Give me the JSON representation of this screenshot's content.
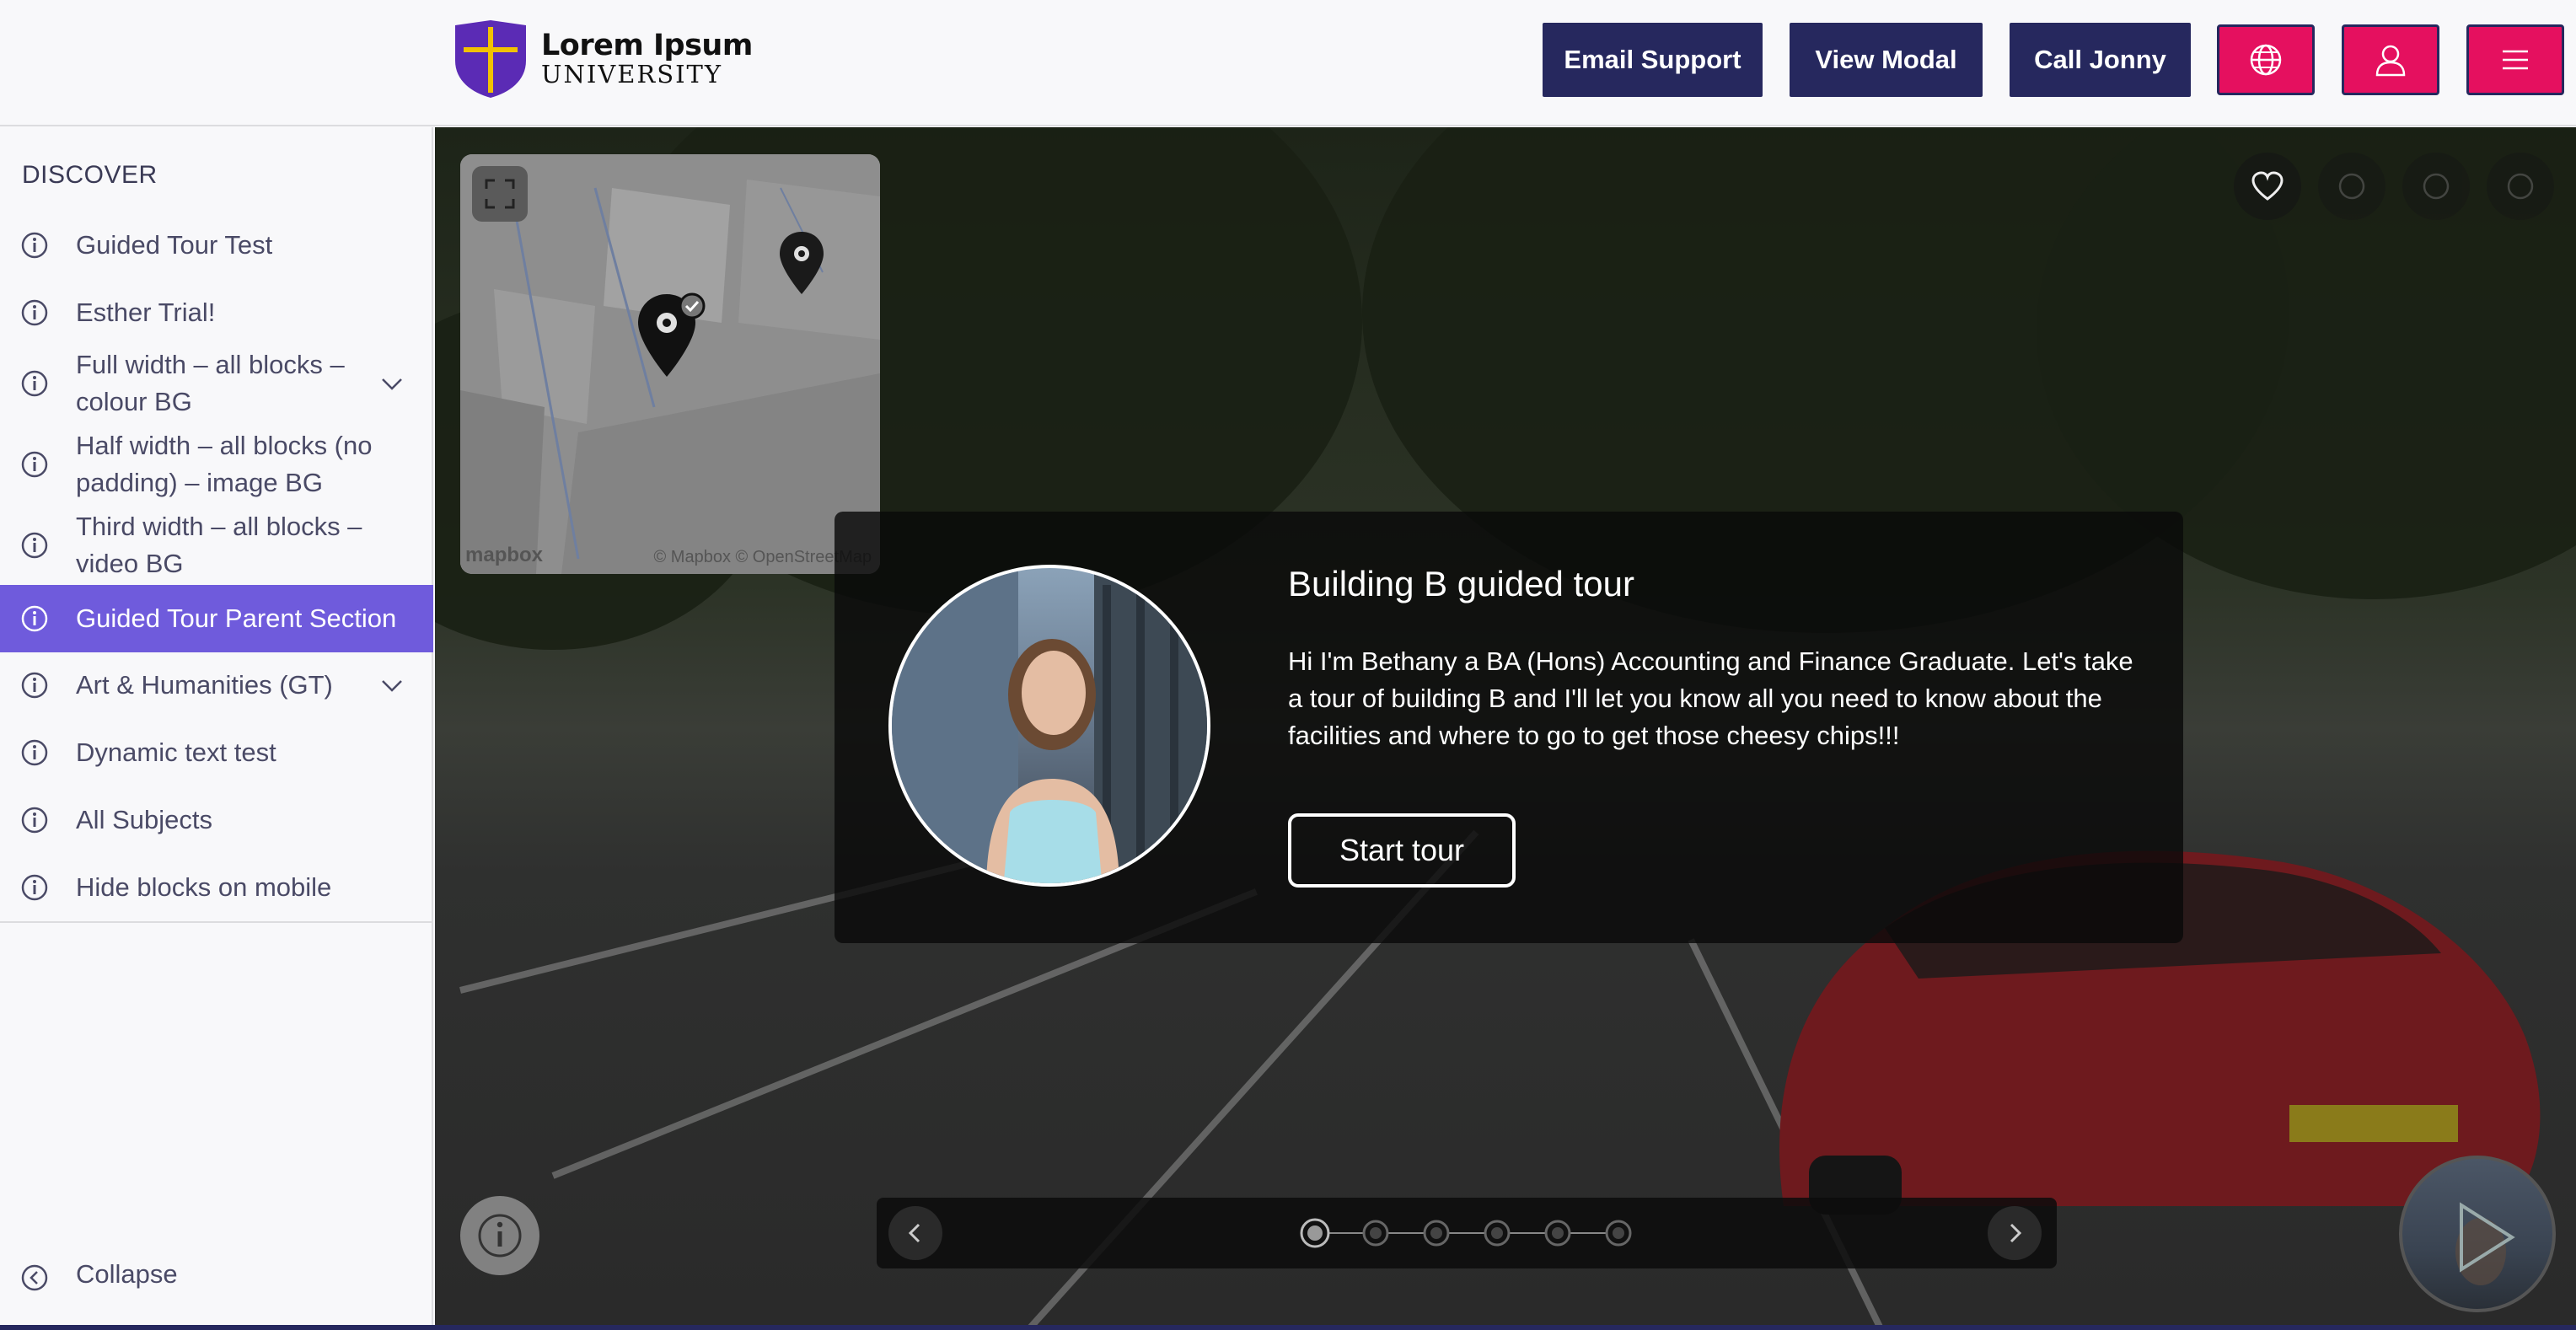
{
  "header": {
    "logo": {
      "line1": "Lorem Ipsum",
      "line2": "UNIVERSITY",
      "shield_color": "#5b2bb5",
      "cross_color": "#f2c200"
    },
    "buttons": [
      {
        "label": "Email Support"
      },
      {
        "label": "View Modal"
      },
      {
        "label": "Call Jonny"
      }
    ],
    "icon_buttons": [
      "globe-icon",
      "user-icon",
      "menu-icon"
    ],
    "button_color": "#26285e",
    "accent_color": "#e5105f"
  },
  "sidebar": {
    "heading": "DISCOVER",
    "items": [
      {
        "label": "Guided Tour Test",
        "expandable": false,
        "active": false
      },
      {
        "label": "Esther Trial!",
        "expandable": false,
        "active": false
      },
      {
        "label": "Full width – all blocks – colour BG",
        "expandable": true,
        "active": false
      },
      {
        "label": "Half width – all blocks (no padding) – image BG",
        "expandable": false,
        "active": false
      },
      {
        "label": "Third width – all blocks – video BG",
        "expandable": false,
        "active": false
      },
      {
        "label": "Guided Tour Parent Section",
        "expandable": false,
        "active": true
      },
      {
        "label": "Art & Humanities (GT)",
        "expandable": true,
        "active": false
      },
      {
        "label": "Dynamic text test",
        "expandable": false,
        "active": false
      },
      {
        "label": "All Subjects",
        "expandable": false,
        "active": false
      },
      {
        "label": "Hide blocks on mobile",
        "expandable": false,
        "active": false
      }
    ],
    "collapse_label": "Collapse",
    "active_color": "#6f5bdc"
  },
  "map": {
    "attribution_brand": "mapbox",
    "attribution": "© Mapbox  © OpenStreetMap"
  },
  "tour_card": {
    "title": "Building B guided tour",
    "body": "Hi I'm Bethany a BA (Hons) Accounting and Finance Graduate. Let's take a tour of building B and I'll let you know all you need to know about the facilities and where to go to get those cheesy chips!!!",
    "start_label": "Start tour"
  },
  "progress": {
    "steps": 6,
    "current": 1
  },
  "viewer_icons": [
    "heart-icon",
    "share-icon",
    "audio-icon",
    "vr-icon"
  ]
}
